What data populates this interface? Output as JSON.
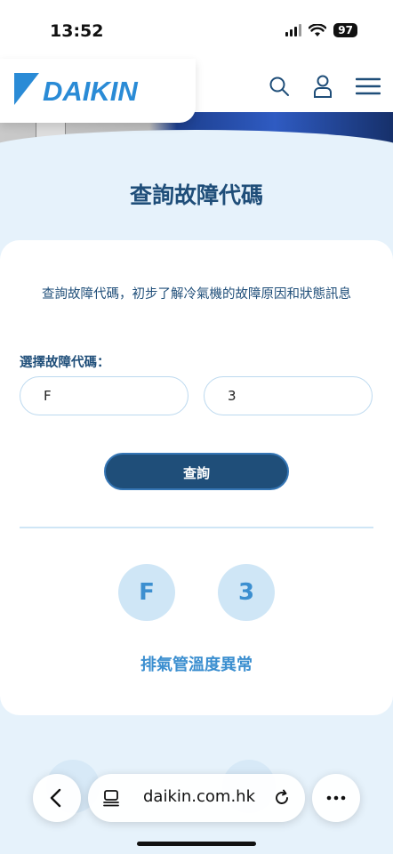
{
  "status_bar": {
    "time": "13:52",
    "battery": "97"
  },
  "header": {
    "logo": "DAIKIN"
  },
  "page": {
    "title": "查詢故障代碼"
  },
  "card": {
    "intro": "查詢故障代碼，初步了解冷氣機的故障原因和狀態訊息",
    "select_label": "選擇故障代碼：",
    "field1_value": "F",
    "field2_value": "3",
    "submit_label": "查詢",
    "code1": "F",
    "code2": "3",
    "result": "排氣管溫度異常"
  },
  "browser": {
    "url": "daikin.com.hk"
  },
  "colors": {
    "brand": "#1f4e79",
    "accent": "#3c8fd0",
    "logo": "#2a8bd6"
  }
}
